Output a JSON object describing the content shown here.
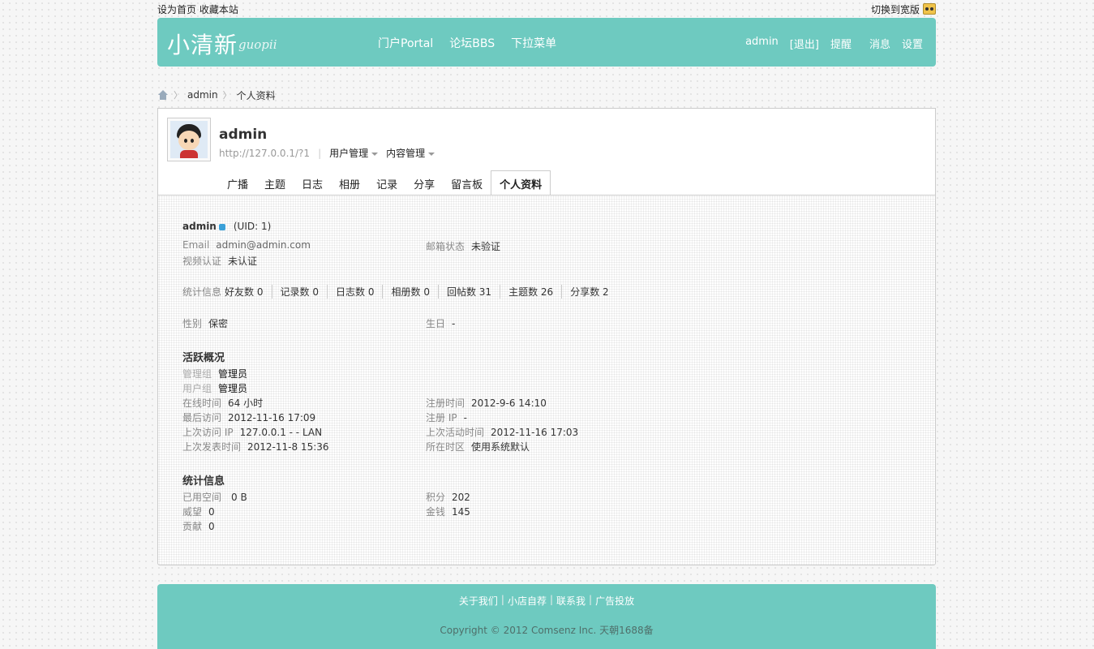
{
  "topbar": {
    "set_home": "设为首页",
    "bookmark": "收藏本站",
    "switch_wide": "切换到宽版"
  },
  "header": {
    "logo": "小清新",
    "logo_sub": "guopii",
    "nav": [
      "门户Portal",
      "论坛BBS",
      "下拉菜单"
    ],
    "user_nav": {
      "username": "admin",
      "logout": "[退出]",
      "remind": "提醒",
      "messages": "消息",
      "settings": "设置"
    }
  },
  "breadcrumb": {
    "user": "admin",
    "page": "个人资料"
  },
  "profile": {
    "name": "admin",
    "url": "http://127.0.0.1/?1",
    "menus": [
      "用户管理",
      "内容管理"
    ],
    "tabs": [
      "广播",
      "主题",
      "日志",
      "相册",
      "记录",
      "分享",
      "留言板",
      "个人资料"
    ],
    "active_tab": "个人资料"
  },
  "info": {
    "username": "admin",
    "uid": "(UID: 1)",
    "email_label": "Email",
    "email": "admin@admin.com",
    "email_status_label": "邮箱状态",
    "email_status": "未验证",
    "video_label": "视频认证",
    "video": "未认证",
    "stats_label": "统计信息",
    "stats": [
      {
        "label": "好友数",
        "value": "0"
      },
      {
        "label": "记录数",
        "value": "0"
      },
      {
        "label": "日志数",
        "value": "0"
      },
      {
        "label": "相册数",
        "value": "0"
      },
      {
        "label": "回帖数",
        "value": "31"
      },
      {
        "label": "主题数",
        "value": "26"
      },
      {
        "label": "分享数",
        "value": "2"
      }
    ],
    "gender_label": "性别",
    "gender": "保密",
    "birthday_label": "生日",
    "birthday": "-"
  },
  "activity": {
    "title": "活跃概况",
    "admin_group_label": "管理组",
    "admin_group": "管理员",
    "user_group_label": "用户组",
    "user_group": "管理员",
    "online_label": "在线时间",
    "online": "64 小时",
    "register_label": "注册时间",
    "register": "2012-9-6 14:10",
    "last_visit_label": "最后访问",
    "last_visit": "2012-11-16 17:09",
    "register_ip_label": "注册 IP",
    "register_ip": "-",
    "last_ip_label": "上次访问 IP",
    "last_ip": "127.0.0.1 - - LAN",
    "last_active_label": "上次活动时间",
    "last_active": "2012-11-16 17:03",
    "last_post_label": "上次发表时间",
    "last_post": "2012-11-8 15:36",
    "timezone_label": "所在时区",
    "timezone": "使用系统默认"
  },
  "statistics": {
    "title": "统计信息",
    "space_label": "已用空间",
    "space": "0 B",
    "credits_label": "积分",
    "credits": "202",
    "prestige_label": "威望",
    "prestige": "0",
    "money_label": "金钱",
    "money": "145",
    "contribution_label": "贡献",
    "contribution": "0"
  },
  "footer": {
    "links": [
      "关于我们",
      "小店自荐",
      "联系我",
      "广告投放"
    ],
    "copyright": "Copyright © 2012 Comsenz Inc. 天朝1688备"
  }
}
